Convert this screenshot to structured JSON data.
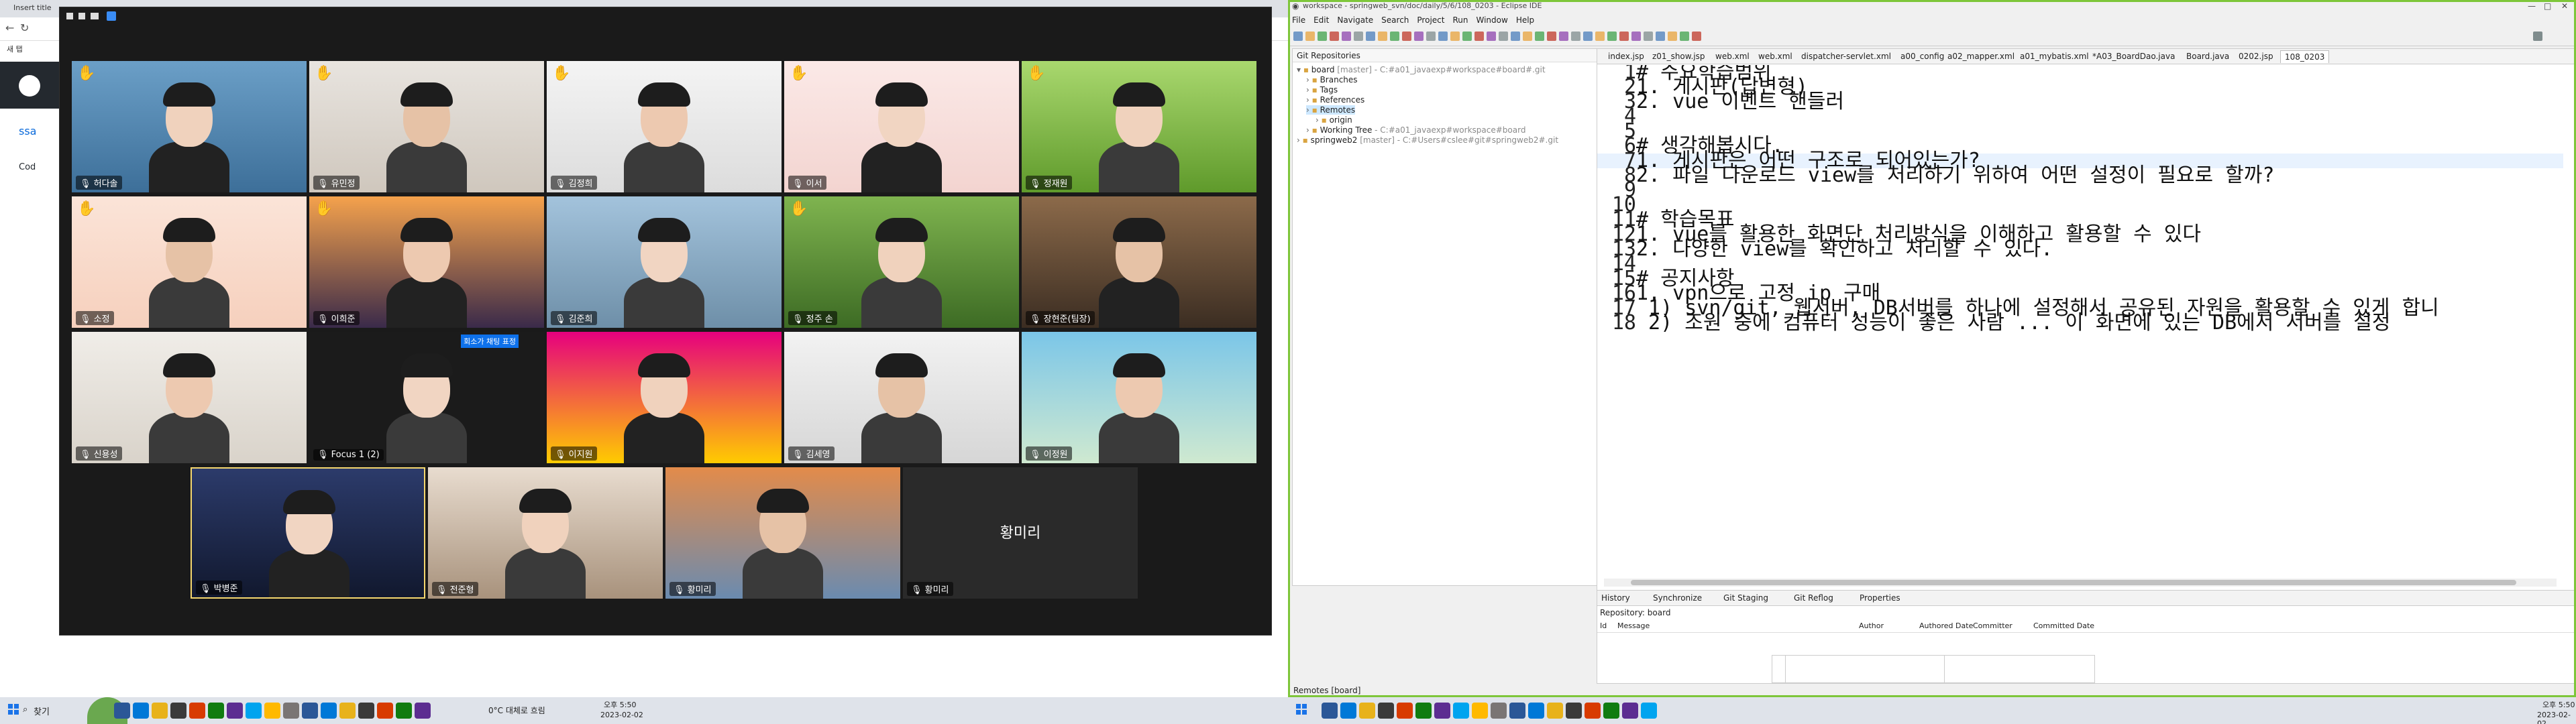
{
  "left_monitor": {
    "browser": {
      "tab_title": "Insert title",
      "bookmark": "새 탭",
      "side_text": "ssa",
      "side_link": "Cod"
    },
    "zoom": {
      "participants": [
        {
          "name": "허다솔",
          "hand": true
        },
        {
          "name": "유민정",
          "hand": true
        },
        {
          "name": "김정희",
          "hand": true
        },
        {
          "name": "이서",
          "hand": true
        },
        {
          "name": "정재원",
          "hand": true
        },
        {
          "name": "소정",
          "hand": true
        },
        {
          "name": "이희준",
          "hand": true
        },
        {
          "name": "김준희",
          "hand": false
        },
        {
          "name": "정주 손",
          "hand": true
        },
        {
          "name": "장현준(팀장)",
          "hand": false
        },
        {
          "name": "신용성",
          "hand": false
        },
        {
          "name": "Focus 1 (2)",
          "hand": false
        },
        {
          "name": "이지원",
          "hand": false
        },
        {
          "name": "김세영",
          "hand": false
        },
        {
          "name": "이정원",
          "hand": false
        },
        {
          "name": "박병준",
          "hand": false
        },
        {
          "name": "전준형",
          "hand": false
        },
        {
          "name": "황미리",
          "hand": false
        },
        {
          "name": "황미리",
          "hand": false
        }
      ],
      "name_only_tile": "황미리",
      "talk_badge": "회소가 채팅 표정"
    },
    "taskbar": {
      "search_label": "찾기",
      "weather": "0°C  대체로 흐림",
      "time": "오후 5:50",
      "date": "2023-02-02"
    }
  },
  "right_monitor": {
    "eclipse": {
      "title": "workspace - springweb_svn/doc/daily/5/6/108_0203 - Eclipse IDE",
      "menu": [
        "File",
        "Edit",
        "Navigate",
        "Search",
        "Project",
        "Run",
        "Window",
        "Help"
      ],
      "git_panel_title": "Git Repositories",
      "tree": [
        {
          "label": "board",
          "detail": "[master] - C:#a01_javaexp#workspace#board#.git",
          "depth": 0,
          "expanded": true
        },
        {
          "label": "Branches",
          "detail": "",
          "depth": 1
        },
        {
          "label": "Tags",
          "detail": "",
          "depth": 1
        },
        {
          "label": "References",
          "detail": "",
          "depth": 1
        },
        {
          "label": "Remotes",
          "detail": "",
          "depth": 1,
          "selected": true
        },
        {
          "label": "origin",
          "detail": "",
          "depth": 2
        },
        {
          "label": "Working Tree",
          "detail": "- C:#a01_javaexp#workspace#board",
          "depth": 1
        },
        {
          "label": "springweb2",
          "detail": "[master] - C:#Users#cslee#git#springweb2#.git",
          "depth": 0
        }
      ],
      "editor_tabs": [
        "index.jsp",
        "z01_show.jsp",
        "web.xml",
        "web.xml",
        "dispatcher-servlet.xml",
        "a00_config",
        "a02_mapper.xml",
        "a01_mybatis.xml",
        "*A03_BoardDao.java",
        "Board.java",
        "0202.jsp",
        "108_0203"
      ],
      "code_lines": [
        "# 주요학습범위",
        "1. 게시판(답변형)",
        "2. vue 이벤트 핸들러",
        "",
        "",
        "# 생각해봅시다.",
        "1. 게시판은 어떤 구조로 되어있는가?",
        "2. 파일 다운로드 view를 처리하기 위하여 어떤 설정이 필요로 할까?",
        "",
        "",
        "# 학습목표",
        "1. vue를 활용한 화면단 처리방식을 이해하고 활용할 수 있다",
        "2. 다양한 view를 확인하고 처리할 수 있다.",
        "",
        "# 공지사항",
        "1. vpn으로 고정 ip 구매",
        "   1) svn/git, 웹서버, DB서버를 하나에 설정해서 공유된 자원을 활용할 수 있게 합니",
        "   2) 조원 중에 컴퓨터 성능이 좋은 사람 ... 이 화면에 있는 DB에서 서버를 설정"
      ],
      "highlight_line": 7,
      "bottom_tabs": [
        "History",
        "Synchronize",
        "Git Staging",
        "Git Reflog",
        "Properties"
      ],
      "repository_label": "Repository: board",
      "history_columns": [
        "Id",
        "Message",
        "Author",
        "Authored Date",
        "Committer",
        "Committed Date"
      ],
      "status_text": "Remotes [board]"
    },
    "taskbar": {
      "time": "오후 5:50",
      "date": "2023-02-02"
    }
  }
}
